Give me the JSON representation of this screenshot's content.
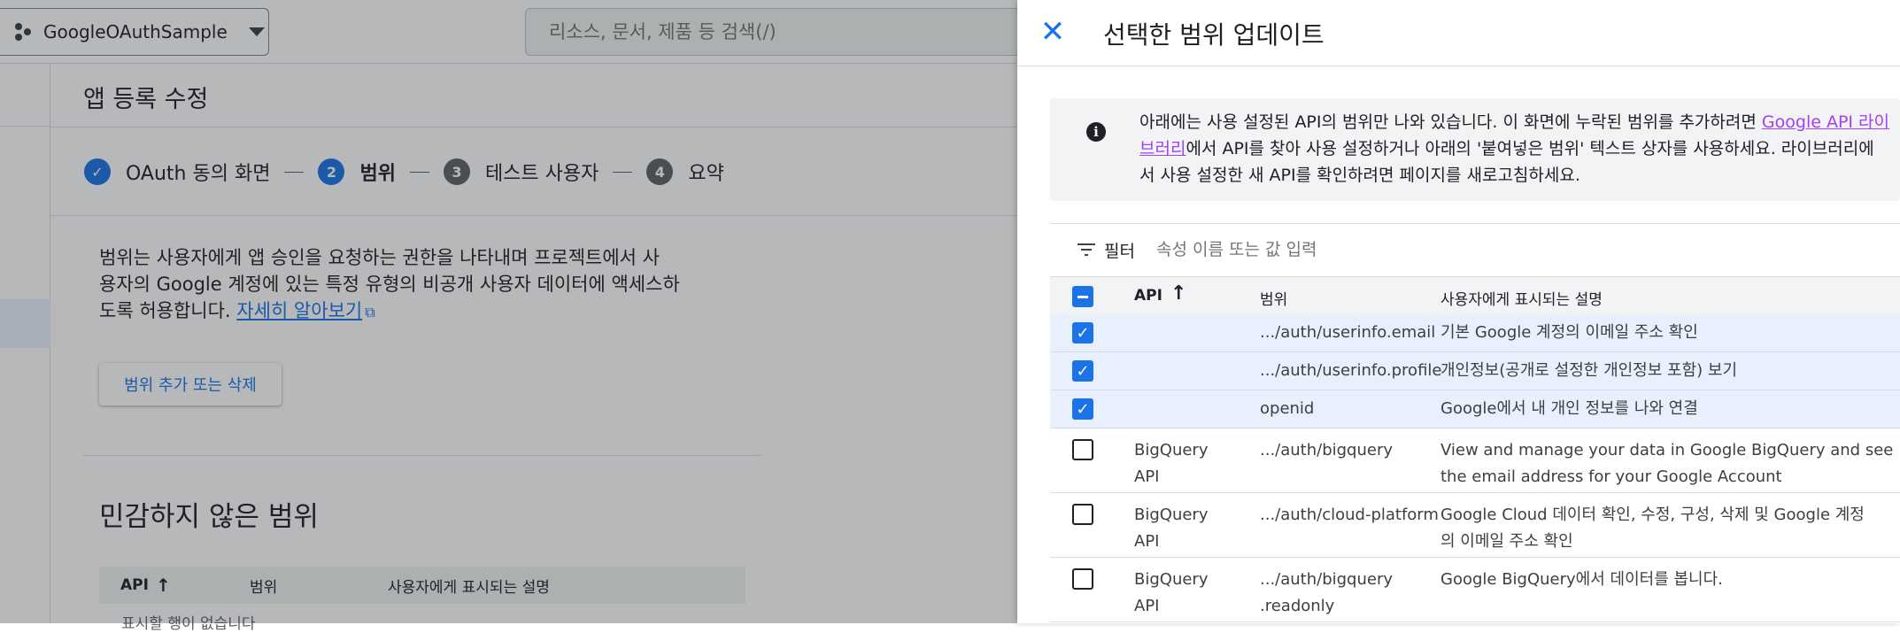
{
  "topbar": {
    "project_name": "GoogleOAuthSample",
    "search_placeholder": "리소스, 문서, 제품 등 검색(/)"
  },
  "page": {
    "title": "앱 등록 수정",
    "steps": [
      {
        "num": "",
        "label": "OAuth 동의 화면",
        "state": "done"
      },
      {
        "num": "2",
        "label": "범위",
        "state": "current"
      },
      {
        "num": "3",
        "label": "테스트 사용자",
        "state": "todo"
      },
      {
        "num": "4",
        "label": "요약",
        "state": "todo"
      }
    ],
    "description_line1": "범위는 사용자에게 앱 승인을 요청하는 권한을 나타내며 프로젝트에서 사",
    "description_line2": "용자의 Google 계정에 있는 특정 유형의 비공개 사용자 데이터에 액세스하",
    "description_line3": "도록 허용합니다. ",
    "learn_more": "자세히 알아보기",
    "add_button": "범위 추가 또는 삭제",
    "section_title": "민감하지 않은 범위",
    "table_headers": {
      "api": "API",
      "scope": "범위",
      "desc": "사용자에게 표시되는 설명"
    },
    "empty_text": "표시할 행이 없습니다"
  },
  "panel": {
    "title": "선택한 범위 업데이트",
    "info_line1_a": "아래에는 사용 설정된 API의 범위만 나와 있습니다. 이 화면에 누락된 범위를 추가하려면 ",
    "info_link_a": "Google API 라이",
    "info_link_b": "브러리",
    "info_line2_rest": "에서 API를 찾아 사용 설정하거나 아래의 '붙여넣은 범위' 텍스트 상자를 사용하세요. 라이브러리에",
    "info_line3": "서 사용 설정한 새 API를 확인하려면 페이지를 새로고침하세요.",
    "filter_label": "필터",
    "filter_placeholder": "속성 이름 또는 값 입력",
    "headers": {
      "api": "API",
      "scope": "범위",
      "desc": "사용자에게 표시되는 설명"
    },
    "rows": [
      {
        "checked": true,
        "api": "",
        "scope": ".../auth/userinfo.email",
        "scope2": "",
        "desc": "기본 Google 계정의 이메일 주소 확인",
        "desc2": ""
      },
      {
        "checked": true,
        "api": "",
        "scope": ".../auth/userinfo.profile",
        "scope2": "",
        "desc": "개인정보(공개로 설정한 개인정보 포함) 보기",
        "desc2": ""
      },
      {
        "checked": true,
        "api": "",
        "scope": "openid",
        "scope2": "",
        "desc": "Google에서 내 개인 정보를 나와 연결",
        "desc2": ""
      },
      {
        "checked": false,
        "api": "BigQuery API",
        "scope": ".../auth/bigquery",
        "scope2": "",
        "desc": "View and manage your data in Google BigQuery and see",
        "desc2": "the email address for your Google Account"
      },
      {
        "checked": false,
        "api": "BigQuery API",
        "scope": ".../auth/cloud-platform",
        "scope2": "",
        "desc": "Google Cloud 데이터 확인, 수정, 구성, 삭제 및 Google 계정",
        "desc2": "의 이메일 주소 확인"
      },
      {
        "checked": false,
        "api": "BigQuery API",
        "scope": ".../auth/bigquery",
        "scope2": ".readonly",
        "desc": "Google BigQuery에서 데이터를 봅니다.",
        "desc2": ""
      }
    ]
  }
}
